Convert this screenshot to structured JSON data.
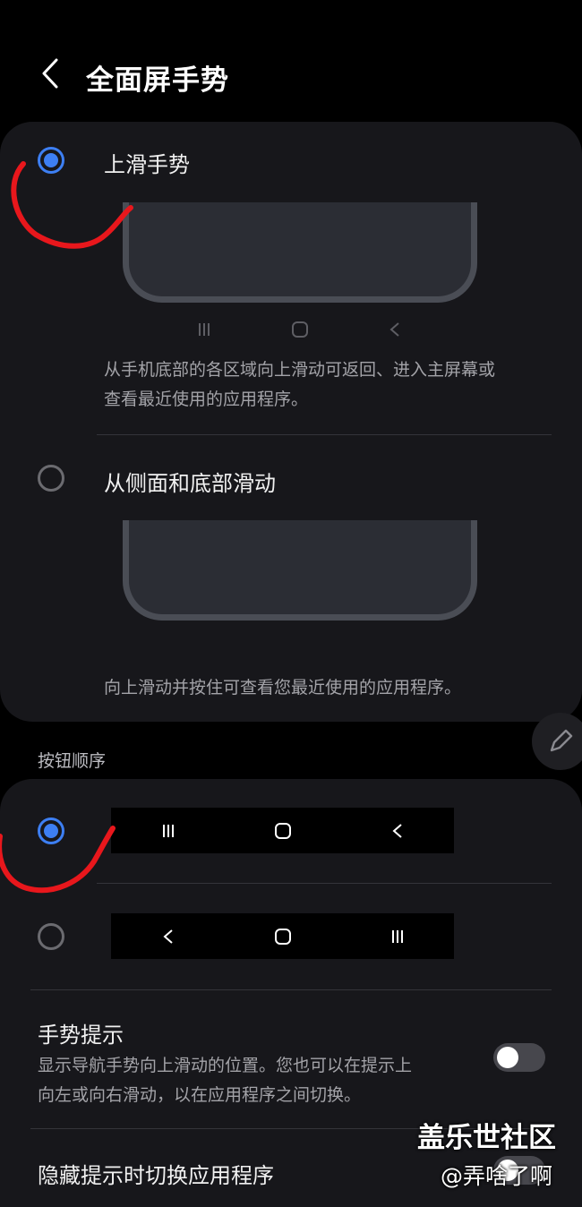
{
  "header": {
    "title": "全面屏手势"
  },
  "gesture_options": [
    {
      "label": "上滑手势",
      "selected": true,
      "description": "从手机底部的各区域向上滑动可返回、进入主屏幕或查看最近使用的应用程序。",
      "desc_line1": "从手机底部的各区域向上滑动可返回、进入主屏幕或",
      "desc_line2": "查看最近使用的应用程序。"
    },
    {
      "label": "从侧面和底部滑动",
      "selected": false,
      "description": "向上滑动并按住可查看您最近使用的应用程序。"
    }
  ],
  "button_order": {
    "section_title": "按钮顺序",
    "options": [
      {
        "selected": true,
        "icons": [
          "recents-icon",
          "home-icon",
          "back-icon"
        ]
      },
      {
        "selected": false,
        "icons": [
          "back-icon",
          "home-icon",
          "recents-icon"
        ]
      }
    ]
  },
  "gesture_hint": {
    "title": "手势提示",
    "desc_line1": "显示导航手势向上滑动的位置。您也可以在提示上",
    "desc_line2": "向左或向右滑动，以在应用程序之间切换。",
    "enabled": false
  },
  "hide_hint_switch": {
    "title": "隐藏提示时切换应用程序"
  },
  "watermark": {
    "line1": "盖乐世社区",
    "line2": "@弄啥了啊"
  },
  "colors": {
    "accent": "#3d7ff3",
    "card": "#17171b",
    "annotation": "#e8171c"
  }
}
